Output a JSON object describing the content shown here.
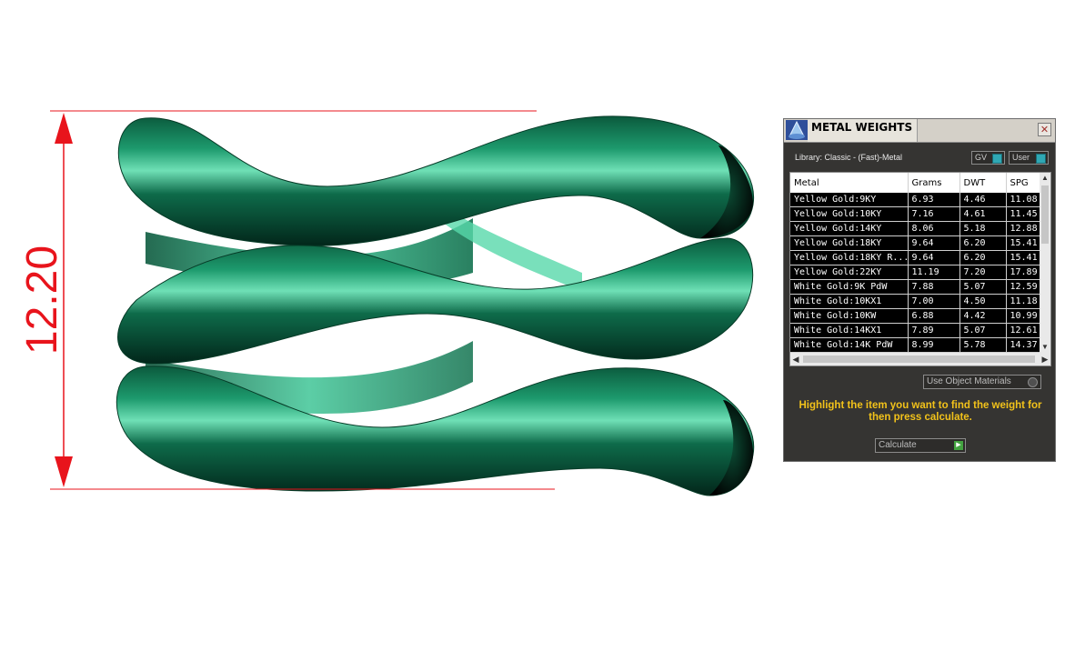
{
  "dimension": {
    "value": "12.20"
  },
  "panel": {
    "title": "METAL WEIGHTS",
    "close_glyph": "✕",
    "library": "Library: Classic - (Fast)-Metal",
    "toggles": {
      "gv_label": "GV",
      "user_label": "User"
    },
    "columns": [
      "Metal",
      "Grams",
      "DWT",
      "SPG"
    ],
    "rows": [
      [
        "Yellow Gold:9KY",
        "6.93",
        "4.46",
        "11.08"
      ],
      [
        "Yellow Gold:10KY",
        "7.16",
        "4.61",
        "11.45"
      ],
      [
        "Yellow Gold:14KY",
        "8.06",
        "5.18",
        "12.88"
      ],
      [
        "Yellow Gold:18KY",
        "9.64",
        "6.20",
        "15.41"
      ],
      [
        "Yellow Gold:18KY R...",
        "9.64",
        "6.20",
        "15.41"
      ],
      [
        "Yellow Gold:22KY",
        "11.19",
        "7.20",
        "17.89"
      ],
      [
        "White Gold:9K PdW",
        "7.88",
        "5.07",
        "12.59"
      ],
      [
        "White Gold:10KX1",
        "7.00",
        "4.50",
        "11.18"
      ],
      [
        "White Gold:10KW",
        "6.88",
        "4.42",
        "10.99"
      ],
      [
        "White Gold:14KX1",
        "7.89",
        "5.07",
        "12.61"
      ],
      [
        "White Gold:14K PdW",
        "8.99",
        "5.78",
        "14.37"
      ]
    ],
    "use_object_materials": "Use Object Materials",
    "hint": "Highlight the item you want to find the weight for then press calculate.",
    "calculate_label": "Calculate"
  },
  "colors": {
    "metal_green": "#0e6b4a",
    "dimension_red": "#e8141c",
    "hint_yellow": "#f2c21a",
    "panel_bg": "#353432"
  },
  "icons": {
    "title_icon": "metal-weights-app-icon",
    "close": "close-icon",
    "calculate": "play-arrow-icon"
  }
}
